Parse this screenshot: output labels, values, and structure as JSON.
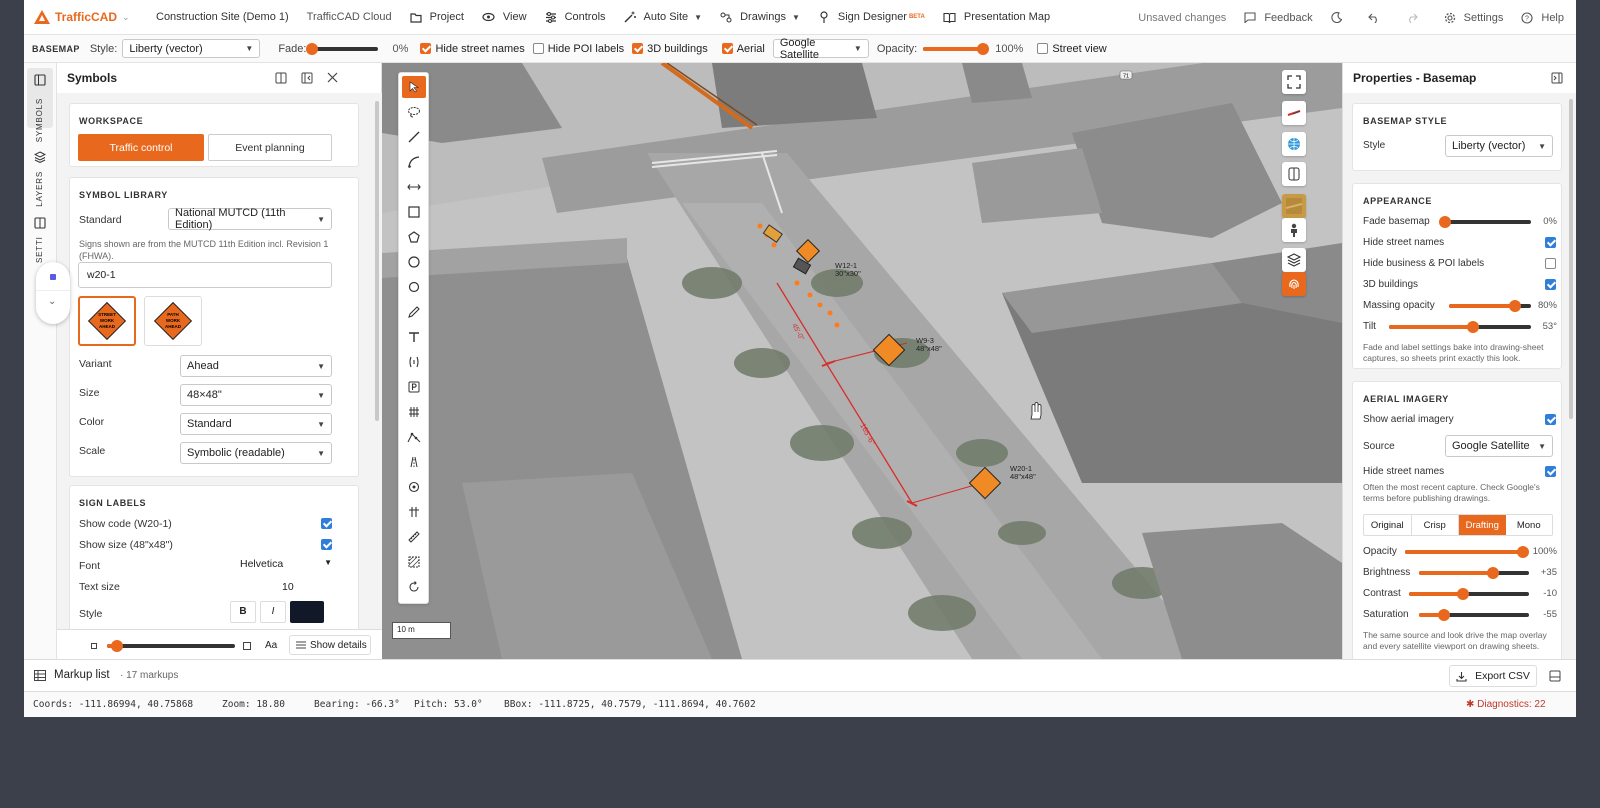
{
  "app": {
    "name": "TrafficCAD"
  },
  "topbar": {
    "project_name": "Construction Site (Demo 1)",
    "cloud": "TrafficCAD Cloud",
    "menus": [
      "Project",
      "View",
      "Controls",
      "Auto Site",
      "Drawings",
      "Sign Designer",
      "Presentation Map"
    ],
    "beta": "BETA",
    "unsaved": "Unsaved changes",
    "feedback": "Feedback",
    "settings": "Settings",
    "help": "Help"
  },
  "basemap_bar": {
    "label": "BASEMAP",
    "style_label": "Style:",
    "style_value": "Liberty (vector)",
    "fade_label": "Fade:",
    "fade_value": "0%",
    "fade": 0,
    "hide_street_names": "Hide street names",
    "hide_poi": "Hide POI labels",
    "buildings_3d": "3D buildings",
    "aerial": "Aerial",
    "aerial_source": "Google Satellite",
    "opacity_label": "Opacity:",
    "opacity_value": "100%",
    "opacity": 1,
    "street_view": "Street view"
  },
  "rail": {
    "symbols": "SYMBOLS",
    "layers": "LAYERS",
    "settings": "SETTINGS"
  },
  "symbols_panel": {
    "title": "Symbols",
    "workspace": {
      "heading": "WORKSPACE",
      "traffic": "Traffic control",
      "event": "Event planning"
    },
    "library": {
      "heading": "SYMBOL LIBRARY",
      "standard_label": "Standard",
      "standard_value": "National MUTCD (11th Edition)",
      "note": "Signs shown are from the MUTCD 11th Edition incl. Revision 1 (FHWA).",
      "search_value": "w20-1",
      "sign1": [
        "STREET",
        "WORK",
        "AHEAD"
      ],
      "sign2": [
        "PATH",
        "WORK",
        "AHEAD"
      ],
      "variant_label": "Variant",
      "variant_value": "Ahead",
      "size_label": "Size",
      "size_value": "48×48\"",
      "color_label": "Color",
      "color_value": "Standard",
      "scale_label": "Scale",
      "scale_value": "Symbolic (readable)"
    },
    "labels": {
      "heading": "SIGN LABELS",
      "show_code": "Show code (W20-1)",
      "show_size": "Show size (48\"x48\")",
      "font_label": "Font",
      "font_value": "Helvetica",
      "text_size_label": "Text size",
      "text_size_value": "10",
      "style_label": "Style",
      "bold": "B",
      "italic": "I"
    },
    "footer": {
      "aa": "Aa",
      "show_details": "Show details",
      "zoom": 0.08
    }
  },
  "map": {
    "scale": "10 m",
    "sign_labels": {
      "w121": [
        "W12-1",
        "30\"x30\""
      ],
      "w93": [
        "W9-3",
        "48\"x48\""
      ],
      "w201": [
        "W20-1",
        "48\"x48\""
      ]
    },
    "dims": {
      "d1": "45'-0\"",
      "d2": "165'-6\"",
      "road": "71"
    }
  },
  "props_panel": {
    "title": "Properties - Basemap",
    "basemap_style": {
      "heading": "BASEMAP STYLE",
      "style_label": "Style",
      "style_value": "Liberty (vector)"
    },
    "appearance": {
      "heading": "APPEARANCE",
      "fade_label": "Fade basemap",
      "fade_value": "0%",
      "fade": 0,
      "hide_street": "Hide street names",
      "hide_biz": "Hide business & POI labels",
      "b3d": "3D buildings",
      "massing_label": "Massing opacity",
      "massing_value": "80%",
      "massing": 0.8,
      "tilt_label": "Tilt",
      "tilt_value": "53°",
      "tilt": 0.59,
      "note": "Fade and label settings bake into drawing-sheet captures, so sheets print exactly this look."
    },
    "aerial": {
      "heading": "AERIAL IMAGERY",
      "show": "Show aerial imagery",
      "source_label": "Source",
      "source_value": "Google Satellite",
      "hide_street": "Hide street names",
      "note": "Often the most recent capture. Check Google's terms before publishing drawings.",
      "modes": [
        "Original",
        "Crisp",
        "Drafting",
        "Mono"
      ],
      "opacity_label": "Opacity",
      "opacity_value": "100%",
      "opacity": 1,
      "brightness_label": "Brightness",
      "brightness_value": "+35",
      "brightness": 0.675,
      "contrast_label": "Contrast",
      "contrast_value": "-10",
      "contrast": 0.45,
      "saturation_label": "Saturation",
      "saturation_value": "-55",
      "saturation": 0.225,
      "footnote": "The same source and look drive the map overlay and every satellite viewport on drawing sheets."
    }
  },
  "markup": {
    "title": "Markup list",
    "count": "· 17 markups",
    "export": "Export CSV"
  },
  "status": {
    "coords": "Coords: -111.86994, 40.75868",
    "zoom": "Zoom: 18.80",
    "bearing": "Bearing: -66.3°",
    "pitch": "Pitch: 53.0°",
    "bbox": "BBox: -111.8725, 40.7579, -111.8694, 40.7602",
    "diagnostics": "Diagnostics: 22"
  },
  "colors": {
    "accent": "#e8691d",
    "check_blue": "#2f7fd8",
    "diag_red": "#c0392b"
  }
}
